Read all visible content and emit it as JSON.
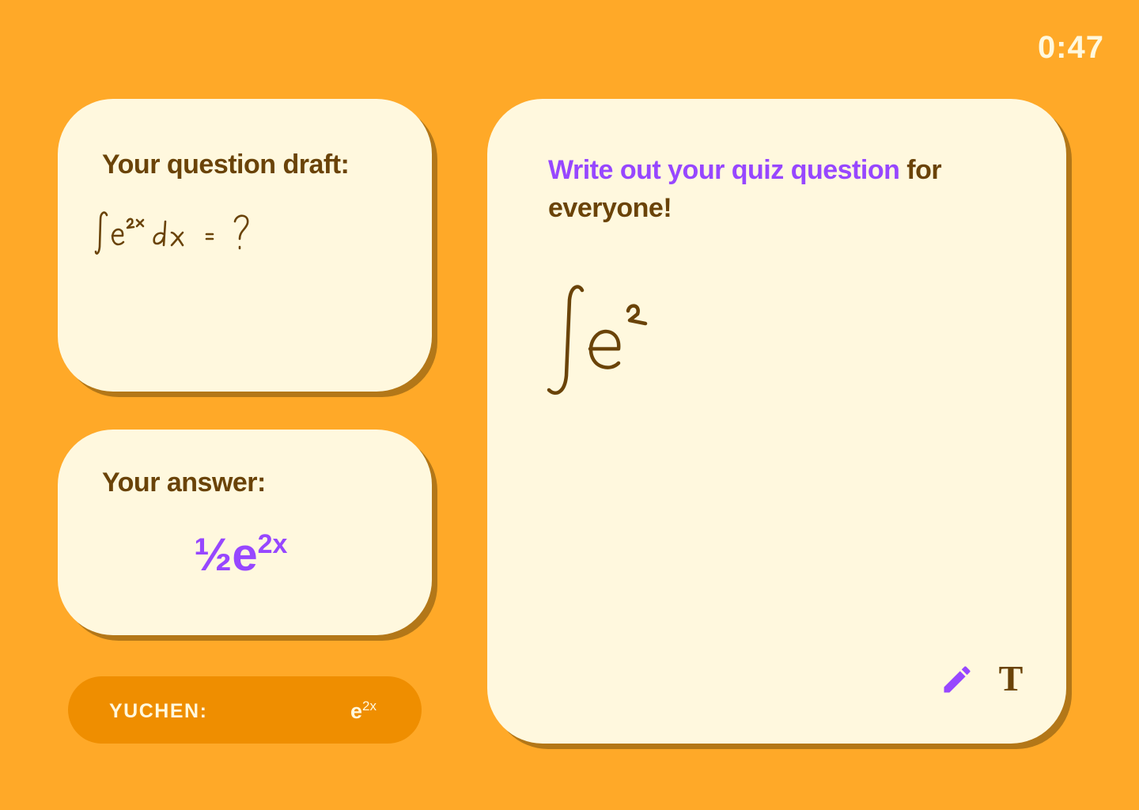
{
  "timer": "0:47",
  "draft": {
    "title": "Your question draft:",
    "ink_content": "∫e^2x dx = ?"
  },
  "answer": {
    "title": "Your answer:",
    "fraction": "½",
    "base": "e",
    "exponent": "2x"
  },
  "canvas": {
    "prompt_accent": "Write out your quiz question",
    "prompt_rest": " for everyone!",
    "ink_content": "∫e^2",
    "tools": [
      {
        "name": "pencil-icon",
        "label": ""
      },
      {
        "name": "text-tool",
        "label": "T"
      }
    ]
  },
  "player": {
    "name": "YUCHEN:",
    "answer_base": "e",
    "answer_exponent": "2x"
  },
  "colors": {
    "background": "#FFA928",
    "card": "#FFF8DE",
    "card_shadow": "#B37718",
    "text": "#6A4308",
    "accent": "#9747FF",
    "player_bar": "#EF8E00"
  }
}
